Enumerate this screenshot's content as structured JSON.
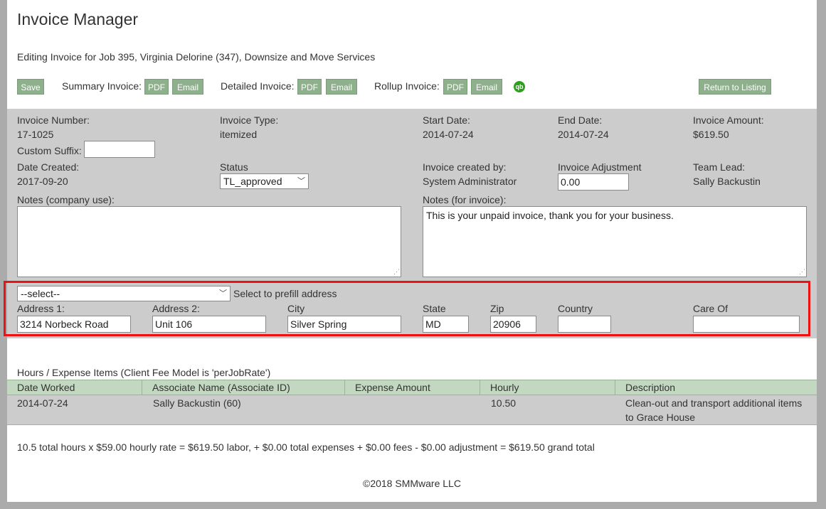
{
  "app": {
    "title": "Invoice Manager"
  },
  "subtitle": "Editing Invoice for Job 395, Virginia Delorine (347), Downsize and Move Services",
  "toolbar": {
    "save_label": "Save",
    "summary_label": "Summary Invoice:",
    "detailed_label": "Detailed Invoice:",
    "rollup_label": "Rollup Invoice:",
    "pdf_label": "PDF",
    "email_label": "Email",
    "return_label": "Return to Listing",
    "qb_label": "qb"
  },
  "invoice": {
    "number_label": "Invoice Number:",
    "number": "17-1025",
    "type_label": "Invoice Type:",
    "type": "itemized",
    "start_label": "Start Date:",
    "start": "2014-07-24",
    "end_label": "End Date:",
    "end": "2014-07-24",
    "amount_label": "Invoice Amount:",
    "amount": "$619.50",
    "suffix_label": "Custom Suffix:",
    "suffix_value": "",
    "created_label": "Date Created:",
    "created": "2017-09-20",
    "status_label": "Status",
    "status_value": "TL_approved",
    "created_by_label": "Invoice created by:",
    "created_by": "System Administrator",
    "adjustment_label": "Invoice Adjustment",
    "adjustment_value": "0.00",
    "team_lead_label": "Team Lead:",
    "team_lead": "Sally Backustin",
    "notes_company_label": "Notes (company use):",
    "notes_company": "",
    "notes_invoice_label": "Notes (for invoice):",
    "notes_invoice": "This is your unpaid invoice, thank you for your business."
  },
  "address": {
    "prefill_value": "--select--",
    "prefill_hint": "Select to prefill address",
    "address1_label": "Address 1:",
    "address1": "3214 Norbeck Road",
    "address2_label": "Address 2:",
    "address2": "Unit 106",
    "city_label": "City",
    "city": "Silver Spring",
    "state_label": "State",
    "state": "MD",
    "zip_label": "Zip",
    "zip": "20906",
    "country_label": "Country",
    "country": "",
    "care_of_label": "Care Of",
    "care_of": ""
  },
  "items": {
    "heading": "Hours / Expense Items (Client Fee Model is 'perJobRate')",
    "columns": [
      "Date Worked",
      "Associate Name (Associate ID)",
      "Expense Amount",
      "Hourly",
      "Description"
    ],
    "rows": [
      {
        "date": "2014-07-24",
        "associate": "Sally Backustin (60)",
        "expense": "",
        "hourly": "10.50",
        "description_line1": "Clean-out and transport additional items",
        "description_line2": "to Grace House"
      }
    ]
  },
  "summary": "10.5 total hours x $59.00 hourly rate = $619.50 labor, + $0.00 total expenses + $0.00 fees - $0.00 adjustment = $619.50 grand total",
  "footer": "©2018 SMMware LLC",
  "colors": {
    "button": "#8fb08c",
    "panel": "#cccccc",
    "table_header": "#c3d8c0",
    "highlight": "#ee1111",
    "qb": "#2ca01c"
  }
}
